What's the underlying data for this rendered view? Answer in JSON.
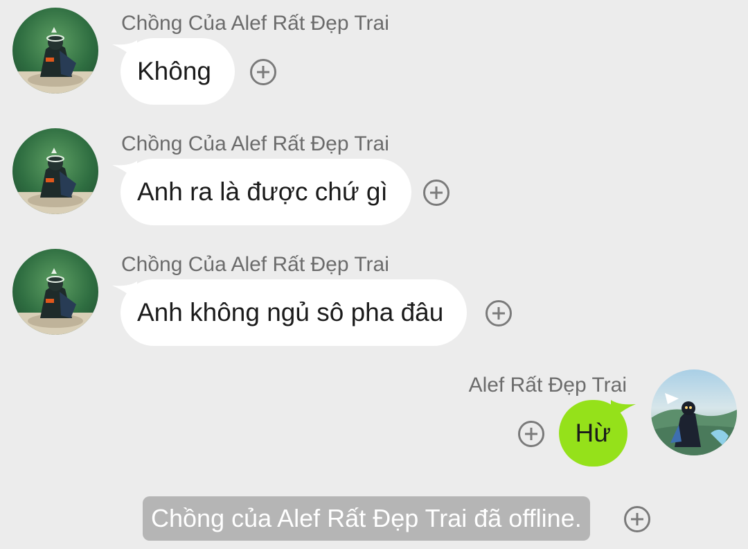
{
  "messages": [
    {
      "sender": "Chồng Của Alef Rất Đẹp Trai",
      "text": "Không",
      "direction": "incoming"
    },
    {
      "sender": "Chồng Của Alef Rất Đẹp Trai",
      "text": "Anh ra là được chứ gì",
      "direction": "incoming"
    },
    {
      "sender": "Chồng Của Alef Rất Đẹp Trai",
      "text": "Anh không ngủ sô pha đâu",
      "direction": "incoming"
    },
    {
      "sender": "Alef Rất Đẹp Trai",
      "text": "Hừ",
      "direction": "outgoing"
    }
  ],
  "system_notice": {
    "text": "Chồng của Alef Rất Đẹp Trai đã offline."
  },
  "icons": {
    "reaction": "plus-circle-icon"
  },
  "colors": {
    "background": "#ececec",
    "incoming_bubble": "#ffffff",
    "outgoing_bubble": "#95e11a",
    "system_pill": "#b5b5b5",
    "name_text": "#6b6b6b"
  }
}
